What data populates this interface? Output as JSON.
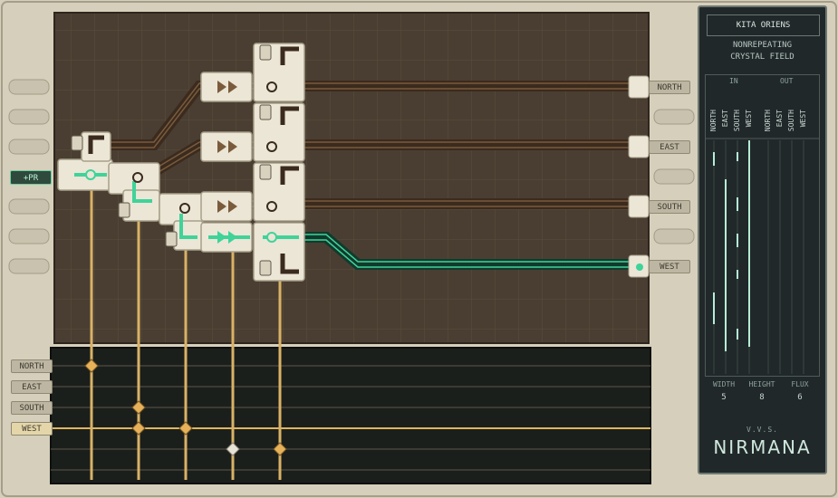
{
  "inputs": {
    "north": "NORTH",
    "east": "EAST",
    "south": "SOUTH",
    "west": "WEST"
  },
  "outputs": {
    "north": "NORTH",
    "east": "EAST",
    "south": "SOUTH",
    "west": "WEST"
  },
  "action_button": "+PR",
  "panel": {
    "title": "KITA ORIENS",
    "subtitle_line1": "NONREPEATING",
    "subtitle_line2": "CRYSTAL FIELD",
    "in_header": "IN",
    "out_header": "OUT",
    "in_channels": [
      "NORTH",
      "EAST",
      "SOUTH",
      "WEST"
    ],
    "out_channels": [
      "NORTH",
      "EAST",
      "SOUTH",
      "WEST"
    ],
    "stats": {
      "width_label": "WIDTH",
      "width": "5",
      "height_label": "HEIGHT",
      "height": "8",
      "flux_label": "FLUX",
      "flux": "6"
    },
    "brand_small": "V.V.S.",
    "brand_big": "NIRMANA"
  },
  "colors": {
    "accent_green": "#3fd39a",
    "wire_gold": "#d9b266",
    "board": "#4a3e32",
    "bus": "#1b1f1c"
  }
}
